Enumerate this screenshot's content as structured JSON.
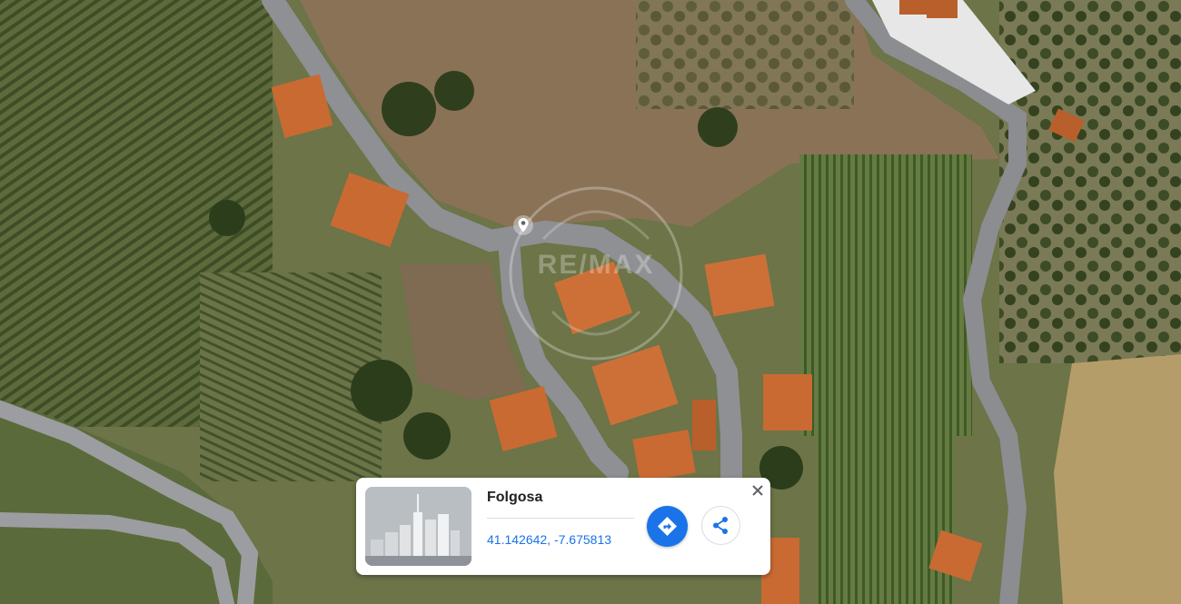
{
  "map": {
    "view": "satellite",
    "watermark_text": "RE/MAX",
    "icons": {
      "pin": "location-pin-icon",
      "directions": "directions-diamond-icon",
      "share": "share-icon",
      "close": "close-icon"
    }
  },
  "card": {
    "title": "Folgosa",
    "coordinates": "41.142642, -7.675813",
    "thumbnail": "street-view-placeholder"
  },
  "colors": {
    "accent": "#1a73e8",
    "roof": "#c96a32",
    "road": "#8e9094"
  }
}
